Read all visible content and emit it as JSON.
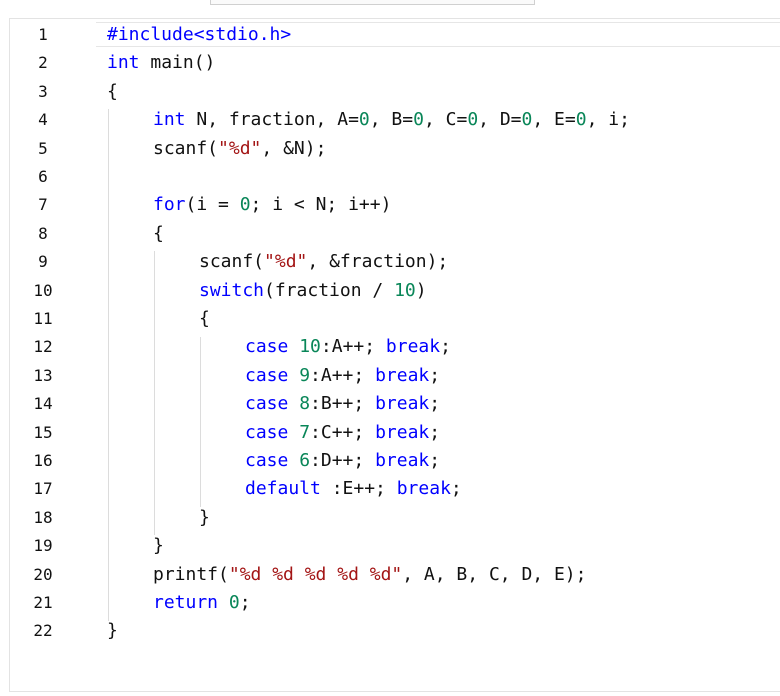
{
  "editor": {
    "lines": [
      {
        "no": "1",
        "indent": 0,
        "tokens": [
          {
            "t": "#include<stdio.h>",
            "k": "kw"
          }
        ]
      },
      {
        "no": "2",
        "indent": 0,
        "tokens": [
          {
            "t": "int",
            "k": "kw"
          },
          {
            "t": " main()",
            "k": ""
          }
        ]
      },
      {
        "no": "3",
        "indent": 0,
        "tokens": [
          {
            "t": "{",
            "k": ""
          }
        ]
      },
      {
        "no": "4",
        "indent": 1,
        "tokens": [
          {
            "t": "int",
            "k": "kw"
          },
          {
            "t": " N, fraction, A=",
            "k": ""
          },
          {
            "t": "0",
            "k": "num"
          },
          {
            "t": ", B=",
            "k": ""
          },
          {
            "t": "0",
            "k": "num"
          },
          {
            "t": ", C=",
            "k": ""
          },
          {
            "t": "0",
            "k": "num"
          },
          {
            "t": ", D=",
            "k": ""
          },
          {
            "t": "0",
            "k": "num"
          },
          {
            "t": ", E=",
            "k": ""
          },
          {
            "t": "0",
            "k": "num"
          },
          {
            "t": ", i;",
            "k": ""
          }
        ]
      },
      {
        "no": "5",
        "indent": 1,
        "tokens": [
          {
            "t": "scanf(",
            "k": ""
          },
          {
            "t": "\"%d\"",
            "k": "str"
          },
          {
            "t": ", &N);",
            "k": ""
          }
        ]
      },
      {
        "no": "6",
        "indent": 1,
        "tokens": []
      },
      {
        "no": "7",
        "indent": 1,
        "tokens": [
          {
            "t": "for",
            "k": "kw"
          },
          {
            "t": "(i = ",
            "k": ""
          },
          {
            "t": "0",
            "k": "num"
          },
          {
            "t": "; i < N; i++)",
            "k": ""
          }
        ]
      },
      {
        "no": "8",
        "indent": 1,
        "tokens": [
          {
            "t": "{",
            "k": ""
          }
        ]
      },
      {
        "no": "9",
        "indent": 2,
        "tokens": [
          {
            "t": "scanf(",
            "k": ""
          },
          {
            "t": "\"%d\"",
            "k": "str"
          },
          {
            "t": ", &fraction);",
            "k": ""
          }
        ]
      },
      {
        "no": "10",
        "indent": 2,
        "tokens": [
          {
            "t": "switch",
            "k": "kw"
          },
          {
            "t": "(fraction / ",
            "k": ""
          },
          {
            "t": "10",
            "k": "num"
          },
          {
            "t": ")",
            "k": ""
          }
        ]
      },
      {
        "no": "11",
        "indent": 2,
        "tokens": [
          {
            "t": "{",
            "k": ""
          }
        ]
      },
      {
        "no": "12",
        "indent": 3,
        "tokens": [
          {
            "t": "case",
            "k": "kw"
          },
          {
            "t": " ",
            "k": ""
          },
          {
            "t": "10",
            "k": "num"
          },
          {
            "t": ":A++; ",
            "k": ""
          },
          {
            "t": "break",
            "k": "kw"
          },
          {
            "t": ";",
            "k": ""
          }
        ]
      },
      {
        "no": "13",
        "indent": 3,
        "tokens": [
          {
            "t": "case",
            "k": "kw"
          },
          {
            "t": " ",
            "k": ""
          },
          {
            "t": "9",
            "k": "num"
          },
          {
            "t": ":A++; ",
            "k": ""
          },
          {
            "t": "break",
            "k": "kw"
          },
          {
            "t": ";",
            "k": ""
          }
        ]
      },
      {
        "no": "14",
        "indent": 3,
        "tokens": [
          {
            "t": "case",
            "k": "kw"
          },
          {
            "t": " ",
            "k": ""
          },
          {
            "t": "8",
            "k": "num"
          },
          {
            "t": ":B++; ",
            "k": ""
          },
          {
            "t": "break",
            "k": "kw"
          },
          {
            "t": ";",
            "k": ""
          }
        ]
      },
      {
        "no": "15",
        "indent": 3,
        "tokens": [
          {
            "t": "case",
            "k": "kw"
          },
          {
            "t": " ",
            "k": ""
          },
          {
            "t": "7",
            "k": "num"
          },
          {
            "t": ":C++; ",
            "k": ""
          },
          {
            "t": "break",
            "k": "kw"
          },
          {
            "t": ";",
            "k": ""
          }
        ]
      },
      {
        "no": "16",
        "indent": 3,
        "tokens": [
          {
            "t": "case",
            "k": "kw"
          },
          {
            "t": " ",
            "k": ""
          },
          {
            "t": "6",
            "k": "num"
          },
          {
            "t": ":D++; ",
            "k": ""
          },
          {
            "t": "break",
            "k": "kw"
          },
          {
            "t": ";",
            "k": ""
          }
        ]
      },
      {
        "no": "17",
        "indent": 3,
        "tokens": [
          {
            "t": "default",
            "k": "kw"
          },
          {
            "t": " :E++; ",
            "k": ""
          },
          {
            "t": "break",
            "k": "kw"
          },
          {
            "t": ";",
            "k": ""
          }
        ]
      },
      {
        "no": "18",
        "indent": 2,
        "tokens": [
          {
            "t": "}",
            "k": ""
          }
        ]
      },
      {
        "no": "19",
        "indent": 1,
        "tokens": [
          {
            "t": "}",
            "k": ""
          }
        ]
      },
      {
        "no": "20",
        "indent": 1,
        "tokens": [
          {
            "t": "printf(",
            "k": ""
          },
          {
            "t": "\"%d %d %d %d %d\"",
            "k": "str"
          },
          {
            "t": ", A, B, C, D, E);",
            "k": ""
          }
        ]
      },
      {
        "no": "21",
        "indent": 1,
        "tokens": [
          {
            "t": "return",
            "k": "kw"
          },
          {
            "t": " ",
            "k": ""
          },
          {
            "t": "0",
            "k": "num"
          },
          {
            "t": ";",
            "k": ""
          }
        ]
      },
      {
        "no": "22",
        "indent": 0,
        "tokens": [
          {
            "t": "}",
            "k": ""
          }
        ]
      }
    ]
  },
  "colors": {
    "keyword": "#0000ff",
    "string": "#a31515",
    "number": "#098658",
    "text": "#111111"
  }
}
